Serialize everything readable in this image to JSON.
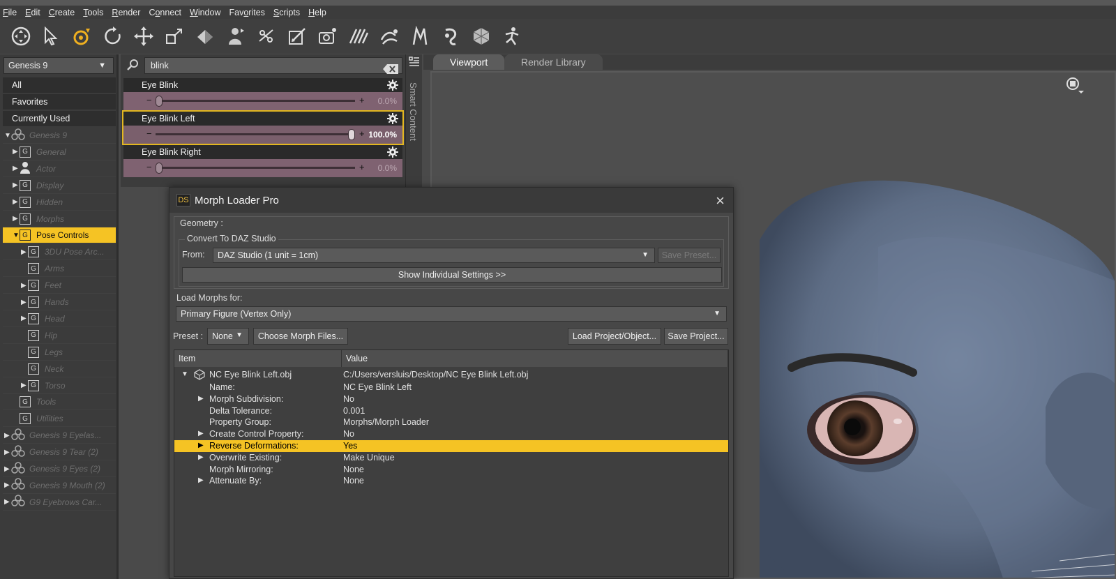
{
  "menu": [
    {
      "u": "F",
      "rest": "ile"
    },
    {
      "u": "E",
      "rest": "dit"
    },
    {
      "u": "C",
      "rest": "reate"
    },
    {
      "u": "T",
      "rest": "ools"
    },
    {
      "u": "R",
      "rest": "ender"
    },
    {
      "pre": "C",
      "u": "o",
      "rest": "nnect"
    },
    {
      "u": "W",
      "rest": "indow"
    },
    {
      "pre": "Fav",
      "u": "o",
      "rest": "rites"
    },
    {
      "u": "S",
      "rest": "cripts"
    },
    {
      "u": "H",
      "rest": "elp"
    }
  ],
  "toolbar_icons": [
    "universal-tool-icon",
    "node-selection-icon",
    "translate-active-icon",
    "rotate-icon",
    "move-icon",
    "scale-icon",
    "surface-selection-icon",
    "figure-icon",
    "joint-editor-icon",
    "geometry-editor-icon",
    "camera-icon",
    "spot-render-icon",
    "region-navigator-icon",
    "active-pose-icon",
    "power-pose-icon",
    "transfer-icon",
    "pose-icon"
  ],
  "left": {
    "figure": "Genesis 9",
    "tabs": [
      "All",
      "Favorites",
      "Currently Used"
    ],
    "tree": [
      {
        "indent": 0,
        "tri": "▼",
        "icon": "figure",
        "label": "Genesis 9"
      },
      {
        "indent": 1,
        "tri": "▶",
        "icon": "G",
        "label": "General"
      },
      {
        "indent": 1,
        "tri": "▶",
        "icon": "actor",
        "label": "Actor"
      },
      {
        "indent": 1,
        "tri": "▶",
        "icon": "G",
        "label": "Display"
      },
      {
        "indent": 1,
        "tri": "▶",
        "icon": "G",
        "label": "Hidden"
      },
      {
        "indent": 1,
        "tri": "▶",
        "icon": "G",
        "label": "Morphs"
      },
      {
        "indent": 1,
        "tri": "▼",
        "icon": "G",
        "label": "Pose Controls",
        "selected": true
      },
      {
        "indent": 2,
        "tri": "▶",
        "icon": "G",
        "label": "3DU Pose Arc..."
      },
      {
        "indent": 2,
        "tri": "",
        "icon": "G",
        "label": "Arms"
      },
      {
        "indent": 2,
        "tri": "▶",
        "icon": "G",
        "label": "Feet"
      },
      {
        "indent": 2,
        "tri": "▶",
        "icon": "G",
        "label": "Hands"
      },
      {
        "indent": 2,
        "tri": "▶",
        "icon": "G",
        "label": "Head"
      },
      {
        "indent": 2,
        "tri": "",
        "icon": "G",
        "label": "Hip"
      },
      {
        "indent": 2,
        "tri": "",
        "icon": "G",
        "label": "Legs"
      },
      {
        "indent": 2,
        "tri": "",
        "icon": "G",
        "label": "Neck"
      },
      {
        "indent": 2,
        "tri": "▶",
        "icon": "G",
        "label": "Torso"
      },
      {
        "indent": 1,
        "tri": "",
        "icon": "G",
        "label": "Tools"
      },
      {
        "indent": 1,
        "tri": "",
        "icon": "G",
        "label": "Utilities"
      },
      {
        "indent": 0,
        "tri": "▶",
        "icon": "figure",
        "label": "Genesis 9 Eyelas..."
      },
      {
        "indent": 0,
        "tri": "▶",
        "icon": "figure",
        "label": "Genesis 9 Tear (2)"
      },
      {
        "indent": 0,
        "tri": "▶",
        "icon": "figure",
        "label": "Genesis 9 Eyes (2)"
      },
      {
        "indent": 0,
        "tri": "▶",
        "icon": "figure",
        "label": "Genesis 9 Mouth (2)"
      },
      {
        "indent": 0,
        "tri": "▶",
        "icon": "figure",
        "label": "G9 Eyebrows Car..."
      }
    ]
  },
  "search": {
    "value": "blink"
  },
  "properties": [
    {
      "label": "Eye Blink",
      "value_text": "0.0%",
      "level": 0.0,
      "highlighted": false
    },
    {
      "label": "Eye Blink Left",
      "value_text": "100.0%",
      "level": 1.0,
      "highlighted": true
    },
    {
      "label": "Eye Blink Right",
      "value_text": "0.0%",
      "level": 0.0,
      "highlighted": false
    }
  ],
  "smart_content_label": "Smart Content",
  "viewport_tabs": [
    "Viewport",
    "Render Library"
  ],
  "dialog": {
    "title": "Morph Loader Pro",
    "logo": "DS",
    "geometry_label": "Geometry :",
    "convert_label": "Convert To DAZ Studio",
    "from_label": "From:",
    "from_value": "DAZ Studio (1 unit = 1cm)",
    "save_preset": "Save Preset...",
    "show_settings": "Show Individual Settings >>",
    "load_morphs_label": "Load Morphs for:",
    "load_morphs_value": "Primary Figure (Vertex Only)",
    "preset_label": "Preset :",
    "preset_value": "None",
    "choose_files": "Choose Morph Files...",
    "load_project": "Load Project/Object...",
    "save_project": "Save Project...",
    "col_item": "Item",
    "col_value": "Value",
    "file_row": {
      "item": "NC Eye Blink Left.obj",
      "value": "C:/Users/versluis/Desktop/NC Eye Blink Left.obj"
    },
    "rows": [
      {
        "k": "Name:",
        "v": "NC Eye Blink Left",
        "ex": ""
      },
      {
        "k": "Morph Subdivision:",
        "v": "No",
        "ex": "▶"
      },
      {
        "k": "Delta Tolerance:",
        "v": "0.001",
        "ex": ""
      },
      {
        "k": "Property Group:",
        "v": "Morphs/Morph Loader",
        "ex": ""
      },
      {
        "k": "Create Control Property:",
        "v": "No",
        "ex": "▶"
      },
      {
        "k": "Reverse Deformations:",
        "v": "Yes",
        "ex": "▶",
        "hl": true
      },
      {
        "k": "Overwrite Existing:",
        "v": "Make Unique",
        "ex": "▶"
      },
      {
        "k": "Morph Mirroring:",
        "v": "None",
        "ex": ""
      },
      {
        "k": "Attenuate By:",
        "v": "None",
        "ex": "▶"
      }
    ]
  }
}
